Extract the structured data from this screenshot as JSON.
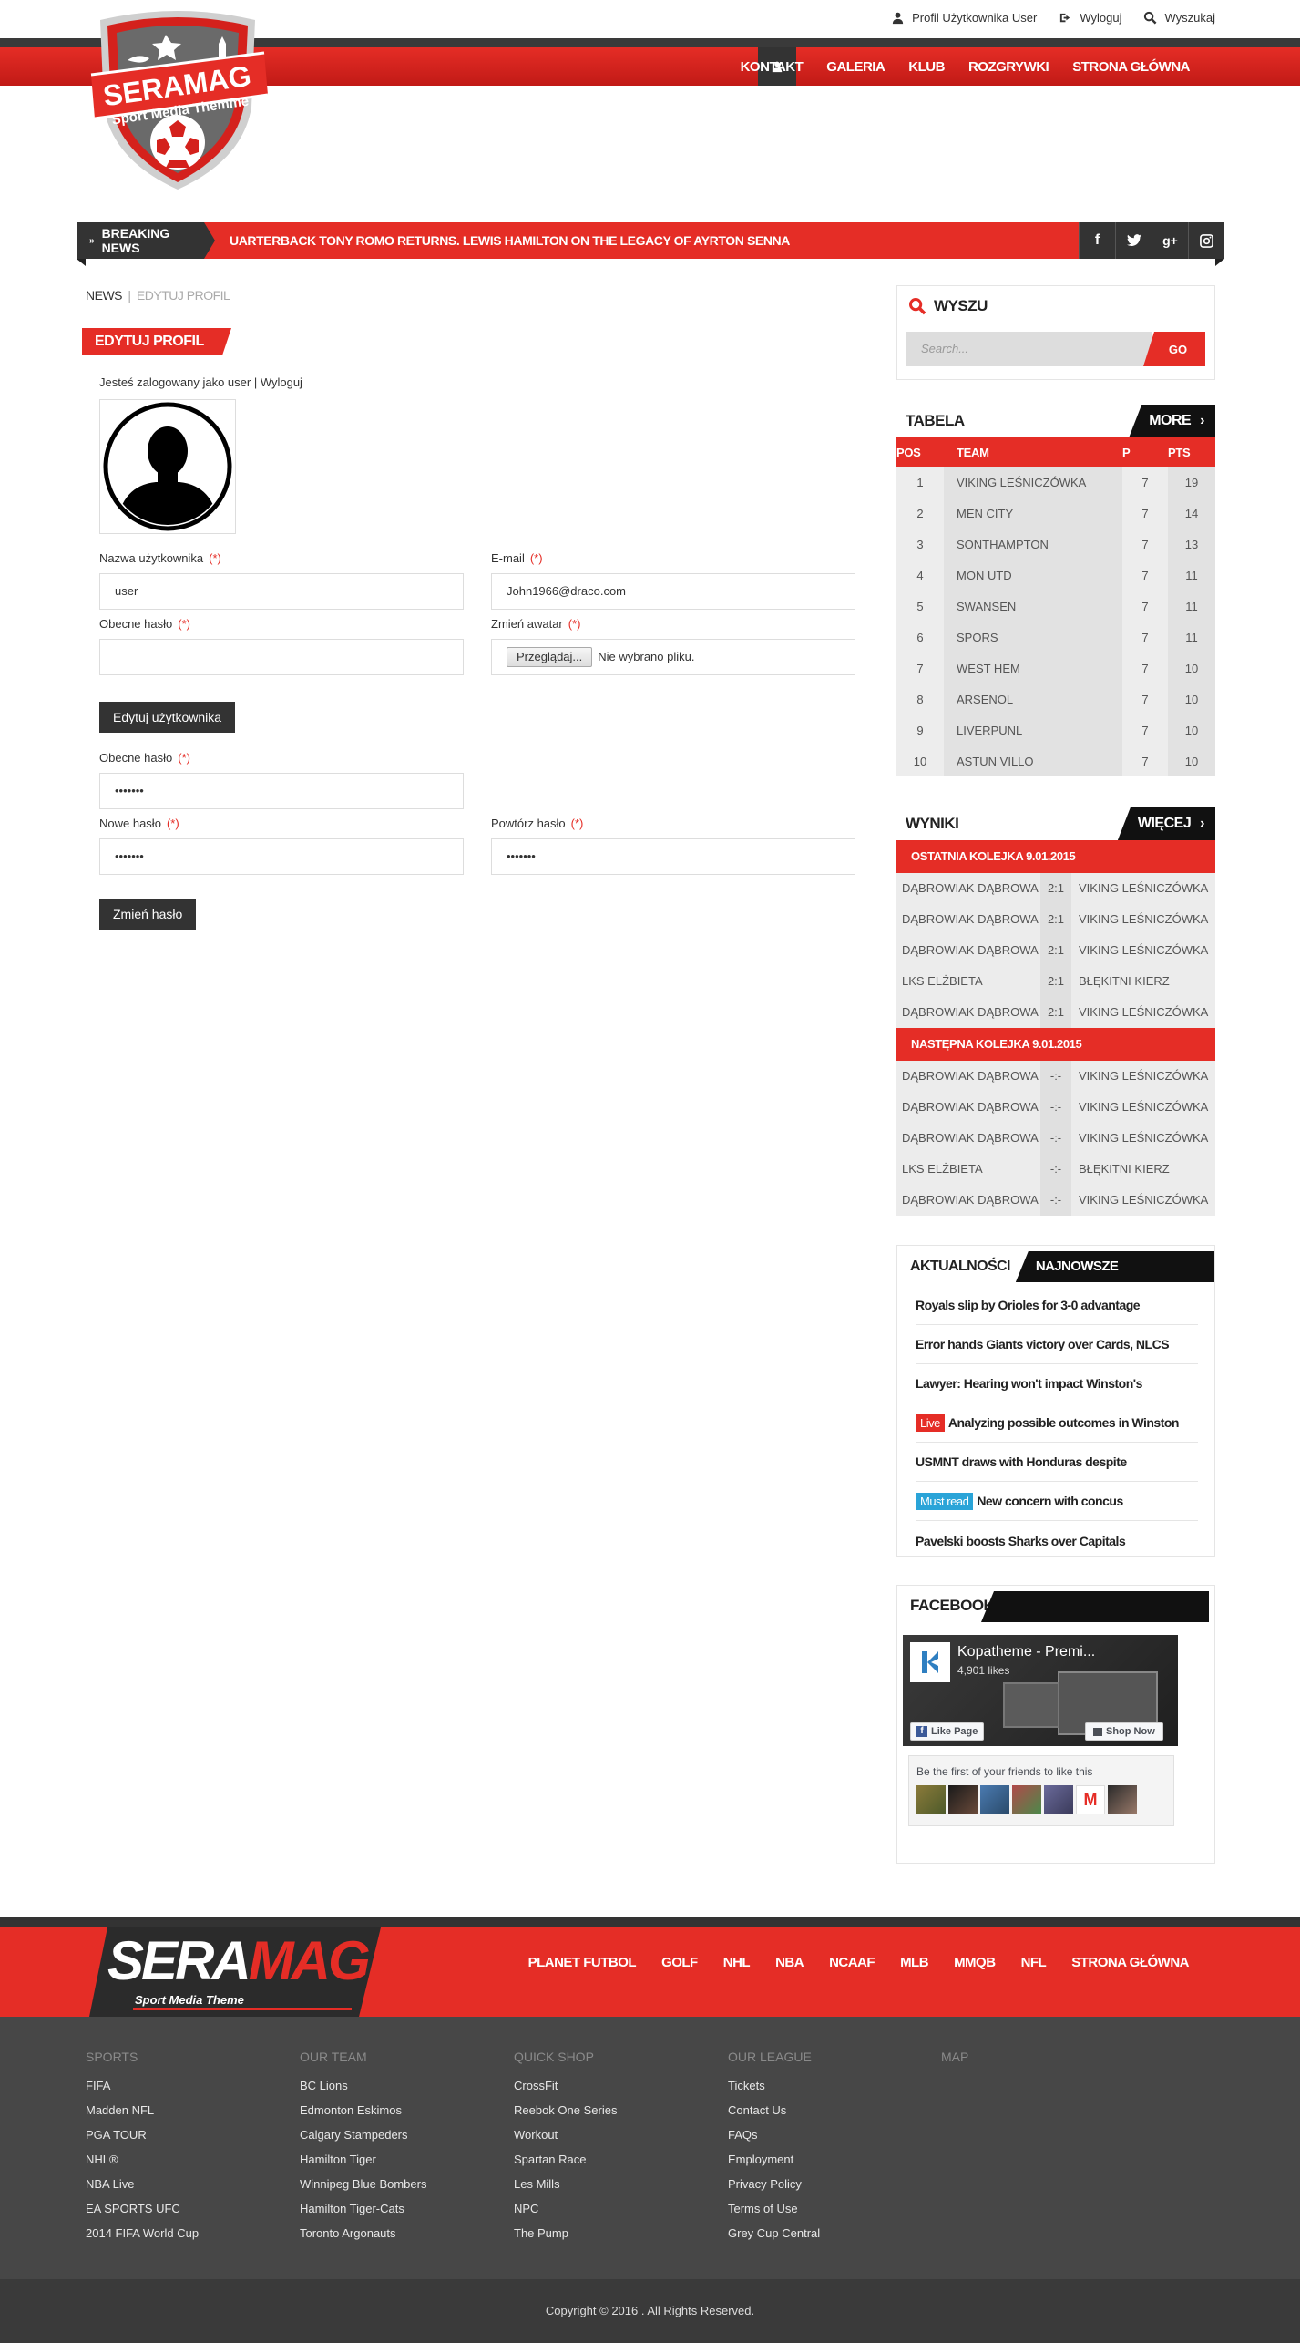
{
  "top_links": {
    "profile": "Profil Użytkownika User",
    "logout": "Wyloguj",
    "search": "Wyszukaj"
  },
  "logo": {
    "brand": "SERAMAG",
    "tagline": "Sport Media Themme"
  },
  "nav": [
    "KONTAKT",
    "GALERIA",
    "KLUB",
    "ROZGRYWKI",
    "STRONA GŁÓWNA"
  ],
  "breaking": {
    "label": "BREAKING NEWS",
    "text": "UARTERBACK TONY ROMO RETURNS. LEWIS HAMILTON ON THE LEGACY OF AYRTON SENNA"
  },
  "breadcrumb": {
    "home": "NEWS",
    "sep": "|",
    "current": "EDYTUJ PROFIL"
  },
  "page_title": "EDYTUJ PROFIL",
  "profile": {
    "logged_prefix": "Jesteś zalogowany jako user |",
    "logged_link": "Wyloguj",
    "username_label": "Nazwa użytkownika",
    "username_value": "user",
    "email_label": "E-mail",
    "email_value": "John1966@draco.com",
    "current_password_label": "Obecne hasło",
    "change_avatar_label": "Zmień awatar",
    "browse_button": "Przeglądaj...",
    "no_file": "Nie wybrano pliku.",
    "edit_user_button": "Edytuj użytkownika",
    "current_password_label_2": "Obecne hasło",
    "current_password_value_2": "•••••••",
    "new_password_label": "Nowe hasło",
    "new_password_value": "•••••••",
    "repeat_password_label": "Powtórz hasło",
    "repeat_password_value": "•••••••",
    "change_password_button": "Zmień hasło",
    "required_mark": "(*)"
  },
  "search_widget": {
    "title": "WYSZU",
    "placeholder": "Search...",
    "go": "GO"
  },
  "table_widget": {
    "title": "TABELA",
    "more": "MORE",
    "headers": [
      "POS",
      "TEAM",
      "P",
      "PTS"
    ],
    "rows": [
      {
        "pos": "1",
        "team": "VIKING LEŚNICZÓWKA",
        "p": "7",
        "pts": "19"
      },
      {
        "pos": "2",
        "team": "MEN CITY",
        "p": "7",
        "pts": "14"
      },
      {
        "pos": "3",
        "team": "SONTHAMPTON",
        "p": "7",
        "pts": "13"
      },
      {
        "pos": "4",
        "team": "MON UTD",
        "p": "7",
        "pts": "11"
      },
      {
        "pos": "5",
        "team": "SWANSEN",
        "p": "7",
        "pts": "11"
      },
      {
        "pos": "6",
        "team": "SPORS",
        "p": "7",
        "pts": "11"
      },
      {
        "pos": "7",
        "team": "WEST HEM",
        "p": "7",
        "pts": "10"
      },
      {
        "pos": "8",
        "team": "ARSENOL",
        "p": "7",
        "pts": "10"
      },
      {
        "pos": "9",
        "team": "LIVERPUNL",
        "p": "7",
        "pts": "10"
      },
      {
        "pos": "10",
        "team": "ASTUN VILLO",
        "p": "7",
        "pts": "10"
      }
    ]
  },
  "results_widget": {
    "title": "WYNIKI",
    "more": "WIĘCEJ",
    "last_round": "OSTATNIA KOLEJKA 9.01.2015",
    "last_matches": [
      {
        "home": "DĄBROWIAK DĄBROWA",
        "score": "2:1",
        "away": "VIKING LEŚNICZÓWKA"
      },
      {
        "home": "DĄBROWIAK DĄBROWA",
        "score": "2:1",
        "away": "VIKING LEŚNICZÓWKA"
      },
      {
        "home": "DĄBROWIAK DĄBROWA",
        "score": "2:1",
        "away": "VIKING LEŚNICZÓWKA"
      },
      {
        "home": "LKS ELŻBIETA",
        "score": "2:1",
        "away": "BŁĘKITNI KIERZ"
      },
      {
        "home": "DĄBROWIAK DĄBROWA",
        "score": "2:1",
        "away": "VIKING LEŚNICZÓWKA"
      }
    ],
    "next_round": "NASTĘPNA KOLEJKA 9.01.2015",
    "next_matches": [
      {
        "home": "DĄBROWIAK DĄBROWA",
        "score": "-:-",
        "away": "VIKING LEŚNICZÓWKA"
      },
      {
        "home": "DĄBROWIAK DĄBROWA",
        "score": "-:-",
        "away": "VIKING LEŚNICZÓWKA"
      },
      {
        "home": "DĄBROWIAK DĄBROWA",
        "score": "-:-",
        "away": "VIKING LEŚNICZÓWKA"
      },
      {
        "home": "LKS ELŻBIETA",
        "score": "-:-",
        "away": "BŁĘKITNI KIERZ"
      },
      {
        "home": "DĄBROWIAK DĄBROWA",
        "score": "-:-",
        "away": "VIKING LEŚNICZÓWKA"
      }
    ]
  },
  "news_widget": {
    "tab1": "AKTUALNOŚCI",
    "tab2": "NAJNOWSZE KOMENTARZE",
    "items": [
      {
        "tag": "",
        "text": "Royals slip by Orioles for 3-0 advantage"
      },
      {
        "tag": "",
        "text": "Error hands Giants victory over Cards, NLCS"
      },
      {
        "tag": "",
        "text": "Lawyer: Hearing won't impact Winston's"
      },
      {
        "tag": "Live",
        "tag_color": "#e52d26",
        "text": "Analyzing possible outcomes in Winston"
      },
      {
        "tag": "",
        "text": "USMNT draws with Honduras despite"
      },
      {
        "tag": "Must read",
        "tag_color": "#2aa4d8",
        "text": "New concern with concus"
      },
      {
        "tag": "",
        "text": "Pavelski boosts Sharks over Capitals"
      }
    ]
  },
  "facebook_widget": {
    "title": "FACEBOOK",
    "page_name": "Kopatheme - Premi...",
    "likes": "4,901 likes",
    "like_page": "Like Page",
    "shop_now": "Shop Now",
    "friends_text": "Be the first of your friends to like this"
  },
  "footer": {
    "brand_part1": "SERA",
    "brand_part2": "MAG",
    "tagline": "Sport Media Theme",
    "nav": [
      "PLANET FUTBOL",
      "GOLF",
      "NHL",
      "NBA",
      "NCAAF",
      "MLB",
      "MMQB",
      "NFL",
      "STRONA GŁÓWNA"
    ],
    "columns": [
      {
        "heading": "SPORTS",
        "items": [
          "FIFA",
          "Madden NFL",
          "PGA TOUR",
          "NHL®",
          "NBA Live",
          "EA SPORTS UFC",
          "2014 FIFA World Cup"
        ]
      },
      {
        "heading": "OUR TEAM",
        "items": [
          "BC Lions",
          "Edmonton Eskimos",
          "Calgary Stampeders",
          "Hamilton Tiger",
          "Winnipeg Blue Bombers",
          "Hamilton Tiger-Cats",
          "Toronto Argonauts"
        ]
      },
      {
        "heading": "QUICK SHOP",
        "items": [
          "CrossFit",
          "Reebok One Series",
          "Workout",
          "Spartan Race",
          "Les Mills",
          "NPC",
          "The Pump"
        ]
      },
      {
        "heading": "OUR LEAGUE",
        "items": [
          "Tickets",
          "Contact Us",
          "FAQs",
          "Employment",
          "Privacy Policy",
          "Terms of Use",
          "Grey Cup Central"
        ]
      },
      {
        "heading": "MAP",
        "items": []
      }
    ],
    "copyright": "Copyright © 2016 . All Rights Reserved."
  },
  "colors": {
    "accent": "#e52d26",
    "dark": "#333333",
    "footer_bg": "#474747",
    "must_read": "#2aa4d8"
  }
}
